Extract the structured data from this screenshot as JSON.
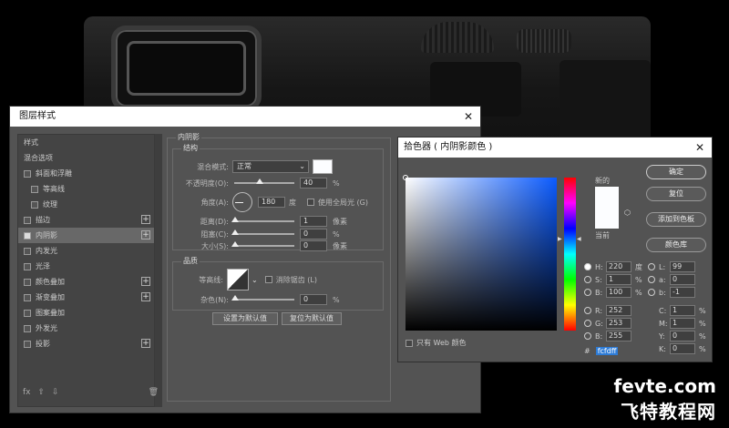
{
  "layer_style": {
    "title": "图层样式",
    "close": "✕",
    "items": [
      {
        "label": "样式",
        "checkbox": false,
        "plus": false,
        "sub": false,
        "selected": false
      },
      {
        "label": "混合选项",
        "checkbox": false,
        "plus": false,
        "sub": false,
        "selected": false
      },
      {
        "label": "斜面和浮雕",
        "checkbox": true,
        "plus": false,
        "sub": false,
        "selected": false
      },
      {
        "label": "等高线",
        "checkbox": true,
        "plus": false,
        "sub": true,
        "selected": false
      },
      {
        "label": "纹理",
        "checkbox": true,
        "plus": false,
        "sub": true,
        "selected": false
      },
      {
        "label": "描边",
        "checkbox": true,
        "plus": true,
        "sub": false,
        "selected": false
      },
      {
        "label": "内阴影",
        "checkbox": true,
        "plus": true,
        "sub": false,
        "selected": true
      },
      {
        "label": "内发光",
        "checkbox": true,
        "plus": false,
        "sub": false,
        "selected": false
      },
      {
        "label": "光泽",
        "checkbox": true,
        "plus": false,
        "sub": false,
        "selected": false
      },
      {
        "label": "颜色叠加",
        "checkbox": true,
        "plus": true,
        "sub": false,
        "selected": false
      },
      {
        "label": "渐变叠加",
        "checkbox": true,
        "plus": true,
        "sub": false,
        "selected": false
      },
      {
        "label": "图案叠加",
        "checkbox": true,
        "plus": false,
        "sub": false,
        "selected": false
      },
      {
        "label": "外发光",
        "checkbox": true,
        "plus": false,
        "sub": false,
        "selected": false
      },
      {
        "label": "投影",
        "checkbox": true,
        "plus": true,
        "sub": false,
        "selected": false
      }
    ],
    "footer": {
      "fx": "fx",
      "up": "⇧",
      "down": "⇩",
      "trash": "🗑"
    },
    "inner_shadow": {
      "title": "内阴影",
      "structure": {
        "title": "结构",
        "blend_mode_label": "混合模式:",
        "blend_mode_value": "正常",
        "opacity_label": "不透明度(O):",
        "opacity_value": "40",
        "opacity_unit": "%",
        "angle_label": "角度(A):",
        "angle_value": "180",
        "angle_unit": "度",
        "global_light_label": "使用全局光 (G)",
        "distance_label": "距离(D):",
        "distance_value": "1",
        "distance_unit": "像素",
        "choke_label": "阻塞(C):",
        "choke_value": "0",
        "choke_unit": "%",
        "size_label": "大小(S):",
        "size_value": "0",
        "size_unit": "像素"
      },
      "quality": {
        "title": "品质",
        "contour_label": "等高线:",
        "antialias_label": "消除锯齿 (L)",
        "noise_label": "杂色(N):",
        "noise_value": "0",
        "noise_unit": "%"
      },
      "set_default": "设置为默认值",
      "reset_default": "复位为默认值",
      "shadow_color": "#fcfdff"
    }
  },
  "color_picker": {
    "title": "拾色器 ( 内阴影颜色 )",
    "close": "✕",
    "new_label": "新的",
    "current_label": "当前",
    "buttons": {
      "ok": "确定",
      "reset": "复位",
      "add_swatch": "添加到色板",
      "libraries": "颜色库"
    },
    "web_only": "只有 Web 颜色",
    "hsb": [
      {
        "label": "H:",
        "value": "220",
        "unit": "度",
        "selected": true
      },
      {
        "label": "S:",
        "value": "1",
        "unit": "%",
        "selected": false
      },
      {
        "label": "B:",
        "value": "100",
        "unit": "%",
        "selected": false
      }
    ],
    "rgb": [
      {
        "label": "R:",
        "value": "252"
      },
      {
        "label": "G:",
        "value": "253"
      },
      {
        "label": "B:",
        "value": "255"
      }
    ],
    "lab": [
      {
        "label": "L:",
        "value": "99"
      },
      {
        "label": "a:",
        "value": "0"
      },
      {
        "label": "b:",
        "value": "-1"
      }
    ],
    "cmyk": [
      {
        "label": "C:",
        "value": "1",
        "unit": "%"
      },
      {
        "label": "M:",
        "value": "1",
        "unit": "%"
      },
      {
        "label": "Y:",
        "value": "0",
        "unit": "%"
      },
      {
        "label": "K:",
        "value": "0",
        "unit": "%"
      }
    ],
    "hex_label": "#",
    "hex_value": "fcfdff",
    "selected_color": "#fcfdff",
    "hue_color": "#0b5bff"
  },
  "watermark": {
    "line1": "fevte.com",
    "line2": "飞特教程网"
  }
}
